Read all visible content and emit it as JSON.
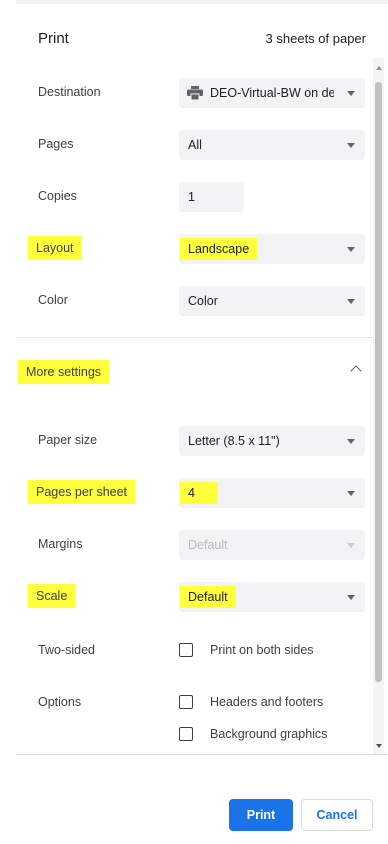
{
  "header": {
    "title": "Print",
    "sheets": "3 sheets of paper"
  },
  "destination": {
    "label": "Destination",
    "value": "DEO-Virtual-BW on dec",
    "icon": "printer-icon"
  },
  "pages": {
    "label": "Pages",
    "value": "All"
  },
  "copies": {
    "label": "Copies",
    "value": "1"
  },
  "layout": {
    "label": "Layout",
    "value": "Landscape"
  },
  "color": {
    "label": "Color",
    "value": "Color"
  },
  "more_settings": {
    "label": "More settings"
  },
  "paper_size": {
    "label": "Paper size",
    "value": "Letter (8.5 x 11\")"
  },
  "pages_per_sheet": {
    "label": "Pages per sheet",
    "value": "4"
  },
  "margins": {
    "label": "Margins",
    "value": "Default"
  },
  "scale": {
    "label": "Scale",
    "value": "Default"
  },
  "two_sided": {
    "label": "Two-sided",
    "checkbox_label": "Print on both sides",
    "checked": false
  },
  "options": {
    "label": "Options",
    "headers_footers": {
      "label": "Headers and footers",
      "checked": false
    },
    "background_graphics": {
      "label": "Background graphics",
      "checked": false
    }
  },
  "footer": {
    "print_label": "Print",
    "cancel_label": "Cancel"
  },
  "colors": {
    "highlight": "#ffff3b",
    "accent": "#1a73e8",
    "field_bg": "#f1f3f4"
  }
}
